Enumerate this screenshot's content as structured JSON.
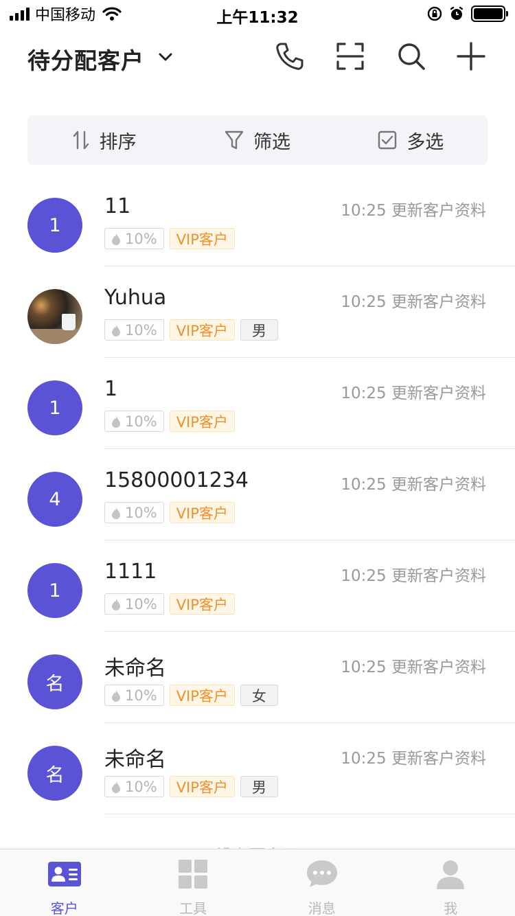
{
  "status_bar": {
    "carrier": "中国移动",
    "time": "上午11:32"
  },
  "header": {
    "title": "待分配客户",
    "icons": [
      "chevron-down-icon",
      "phone-icon",
      "scan-icon",
      "search-icon",
      "plus-icon"
    ]
  },
  "toolbar": {
    "sort_label": "排序",
    "filter_label": "筛选",
    "multiselect_label": "多选"
  },
  "customers": [
    {
      "avatar_text": "1",
      "name": "11",
      "updated": "10:25 更新客户资料",
      "heat": "10%",
      "vip": "VIP客户",
      "gender": ""
    },
    {
      "avatar_text": "",
      "name": "Yuhua",
      "updated": "10:25 更新客户资料",
      "heat": "10%",
      "vip": "VIP客户",
      "gender": "男"
    },
    {
      "avatar_text": "1",
      "name": "1",
      "updated": "10:25 更新客户资料",
      "heat": "10%",
      "vip": "VIP客户",
      "gender": ""
    },
    {
      "avatar_text": "4",
      "name": "15800001234",
      "updated": "10:25 更新客户资料",
      "heat": "10%",
      "vip": "VIP客户",
      "gender": ""
    },
    {
      "avatar_text": "1",
      "name": "1111",
      "updated": "10:25 更新客户资料",
      "heat": "10%",
      "vip": "VIP客户",
      "gender": ""
    },
    {
      "avatar_text": "名",
      "name": "未命名",
      "updated": "10:25 更新客户资料",
      "heat": "10%",
      "vip": "VIP客户",
      "gender": "女"
    },
    {
      "avatar_text": "名",
      "name": "未命名",
      "updated": "10:25 更新客户资料",
      "heat": "10%",
      "vip": "VIP客户",
      "gender": "男"
    }
  ],
  "list_footer": "没有更多了",
  "tabbar": {
    "active": "customers",
    "tabs": [
      {
        "key": "customers",
        "label": "客户",
        "icon": "contact-card-icon"
      },
      {
        "key": "tools",
        "label": "工具",
        "icon": "grid-icon"
      },
      {
        "key": "messages",
        "label": "消息",
        "icon": "chat-bubble-icon"
      },
      {
        "key": "me",
        "label": "我",
        "icon": "person-icon"
      }
    ]
  },
  "colors": {
    "accent": "#5a53d6",
    "vip_text": "#f0902a",
    "vip_bg": "#fff6e6",
    "muted_text": "#999999"
  }
}
